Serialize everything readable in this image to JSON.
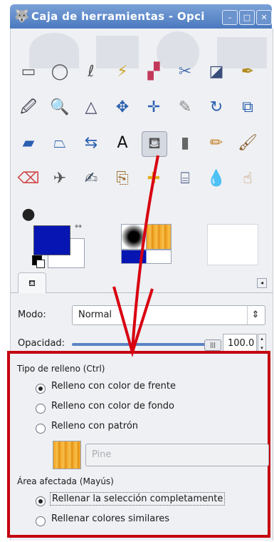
{
  "window": {
    "title": "Caja de herramientas - Opci",
    "buttons": {
      "minimize": "–",
      "maximize": "□",
      "close": "✕"
    }
  },
  "toolbox": {
    "tools": [
      {
        "name": "rect-select-tool",
        "glyph": "▭",
        "color": "#555"
      },
      {
        "name": "ellipse-select-tool",
        "glyph": "◯",
        "color": "#555"
      },
      {
        "name": "free-select-tool",
        "glyph": "ℓ",
        "color": "#555"
      },
      {
        "name": "fuzzy-select-tool",
        "glyph": "⚡",
        "color": "#caa12a"
      },
      {
        "name": "select-by-color-tool",
        "glyph": "▞",
        "color": "#c2385a"
      },
      {
        "name": "scissors-select-tool",
        "glyph": "✂",
        "color": "#4a6fb1"
      },
      {
        "name": "foreground-select-tool",
        "glyph": "◪",
        "color": "#3a4c7a"
      },
      {
        "name": "paths-tool",
        "glyph": "✒",
        "color": "#b08a1a"
      },
      {
        "name": "color-picker-tool",
        "glyph": "🖉",
        "color": "#334"
      },
      {
        "name": "zoom-tool",
        "glyph": "🔍",
        "color": "#446"
      },
      {
        "name": "measure-tool",
        "glyph": "△",
        "color": "#446"
      },
      {
        "name": "move-tool",
        "glyph": "✥",
        "color": "#2b5fb0"
      },
      {
        "name": "align-tool",
        "glyph": "✛",
        "color": "#2b5fb0"
      },
      {
        "name": "crop-tool",
        "glyph": "✎",
        "color": "#888"
      },
      {
        "name": "rotate-tool",
        "glyph": "↻",
        "color": "#2b5fb0"
      },
      {
        "name": "scale-tool",
        "glyph": "⧉",
        "color": "#2b5fb0"
      },
      {
        "name": "shear-tool",
        "glyph": "▰",
        "color": "#2b5fb0"
      },
      {
        "name": "perspective-tool",
        "glyph": "⏢",
        "color": "#2b5fb0"
      },
      {
        "name": "flip-tool",
        "glyph": "⇆",
        "color": "#2b5fb0"
      },
      {
        "name": "text-tool",
        "glyph": "A",
        "color": "#111"
      },
      {
        "name": "bucket-fill-tool",
        "glyph": "⛾",
        "color": "#555"
      },
      {
        "name": "blend-tool",
        "glyph": "▮",
        "color": "#666"
      },
      {
        "name": "pencil-tool",
        "glyph": "✏",
        "color": "#c27a1a"
      },
      {
        "name": "paintbrush-tool",
        "glyph": "🖌",
        "color": "#8a5a2a"
      },
      {
        "name": "eraser-tool",
        "glyph": "⌫",
        "color": "#d04848"
      },
      {
        "name": "airbrush-tool",
        "glyph": "✈",
        "color": "#555"
      },
      {
        "name": "ink-tool",
        "glyph": "✍",
        "color": "#345"
      },
      {
        "name": "clone-tool",
        "glyph": "⎘",
        "color": "#9a6a2a"
      },
      {
        "name": "heal-tool",
        "glyph": "✚",
        "color": "#e0b020"
      },
      {
        "name": "perspective-clone-tool",
        "glyph": "⌸",
        "color": "#3a4c7a"
      },
      {
        "name": "blur-tool",
        "glyph": "💧",
        "color": "#2b7ad0"
      },
      {
        "name": "smudge-tool",
        "glyph": "☝",
        "color": "#c48a5a"
      },
      {
        "name": "dodge-burn-tool",
        "glyph": "●",
        "color": "#222"
      }
    ],
    "selected_tool": "bucket-fill-tool",
    "colors": {
      "foreground": "#0716b3",
      "background": "#ffffff"
    }
  },
  "tab": {
    "label": "⛾",
    "menu": "◂"
  },
  "options": {
    "mode_label": "Modo:",
    "mode_value": "Normal",
    "opacity_label": "Opacidad:",
    "opacity_value": "100.0",
    "opacity_fraction": 1.0,
    "fill_type_title": "Tipo de relleno  (Ctrl)",
    "fill_types": [
      {
        "label": "Relleno con color de frente",
        "selected": true
      },
      {
        "label": "Relleno con color de fondo",
        "selected": false
      },
      {
        "label": "Relleno con patrón",
        "selected": false
      }
    ],
    "pattern_name": "Pine",
    "affected_area_title": "Área afectada  (Mayús)",
    "affected_areas": [
      {
        "label": "Rellenar la selección completamente",
        "selected": true
      },
      {
        "label": "Rellenar colores similares",
        "selected": false
      }
    ]
  },
  "colors": {
    "highlight": "#c40010",
    "arrow": "#d80010"
  }
}
